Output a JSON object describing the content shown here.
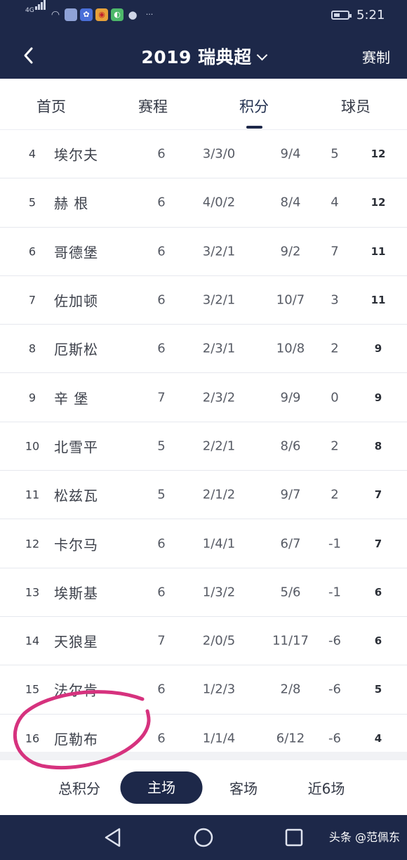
{
  "status_bar": {
    "network": "4G",
    "time": "5:21",
    "battery_level": 0.45,
    "notification_icons": [
      "app-icon",
      "baidu-icon",
      "weibo-icon",
      "browser-icon",
      "chat-icon"
    ],
    "more": "···"
  },
  "nav": {
    "title": "2019 瑞典超",
    "right_label": "赛制"
  },
  "tabs": [
    {
      "label": "首页",
      "active": false
    },
    {
      "label": "赛程",
      "active": false
    },
    {
      "label": "积分",
      "active": true
    },
    {
      "label": "球员",
      "active": false
    }
  ],
  "standings": [
    {
      "rank": "4",
      "team": "埃尔夫",
      "played": "6",
      "wdl": "3/3/0",
      "goals": "9/4",
      "gd": "5",
      "pts": "12"
    },
    {
      "rank": "5",
      "team": "赫 根",
      "played": "6",
      "wdl": "4/0/2",
      "goals": "8/4",
      "gd": "4",
      "pts": "12"
    },
    {
      "rank": "6",
      "team": "哥德堡",
      "played": "6",
      "wdl": "3/2/1",
      "goals": "9/2",
      "gd": "7",
      "pts": "11"
    },
    {
      "rank": "7",
      "team": "佐加顿",
      "played": "6",
      "wdl": "3/2/1",
      "goals": "10/7",
      "gd": "3",
      "pts": "11"
    },
    {
      "rank": "8",
      "team": "厄斯松",
      "played": "6",
      "wdl": "2/3/1",
      "goals": "10/8",
      "gd": "2",
      "pts": "9"
    },
    {
      "rank": "9",
      "team": "辛 堡",
      "played": "7",
      "wdl": "2/3/2",
      "goals": "9/9",
      "gd": "0",
      "pts": "9"
    },
    {
      "rank": "10",
      "team": "北雪平",
      "played": "5",
      "wdl": "2/2/1",
      "goals": "8/6",
      "gd": "2",
      "pts": "8"
    },
    {
      "rank": "11",
      "team": "松兹瓦",
      "played": "5",
      "wdl": "2/1/2",
      "goals": "9/7",
      "gd": "2",
      "pts": "7"
    },
    {
      "rank": "12",
      "team": "卡尔马",
      "played": "6",
      "wdl": "1/4/1",
      "goals": "6/7",
      "gd": "-1",
      "pts": "7"
    },
    {
      "rank": "13",
      "team": "埃斯基",
      "played": "6",
      "wdl": "1/3/2",
      "goals": "5/6",
      "gd": "-1",
      "pts": "6"
    },
    {
      "rank": "14",
      "team": "天狼星",
      "played": "7",
      "wdl": "2/0/5",
      "goals": "11/17",
      "gd": "-6",
      "pts": "6"
    },
    {
      "rank": "15",
      "team": "法尔肯",
      "played": "6",
      "wdl": "1/2/3",
      "goals": "2/8",
      "gd": "-6",
      "pts": "5"
    },
    {
      "rank": "16",
      "team": "厄勒布",
      "played": "6",
      "wdl": "1/1/4",
      "goals": "6/12",
      "gd": "-6",
      "pts": "4"
    }
  ],
  "bottom_tabs": [
    {
      "label": "总积分",
      "active": false
    },
    {
      "label": "主场",
      "active": true
    },
    {
      "label": "客场",
      "active": false
    },
    {
      "label": "近6场",
      "active": false
    }
  ],
  "system_nav": [
    "back-icon",
    "home-icon",
    "recents-icon"
  ],
  "watermark": "头条 @范佩东",
  "colors": {
    "brand_navy": "#1d2849",
    "annotation": "#d6327e"
  }
}
